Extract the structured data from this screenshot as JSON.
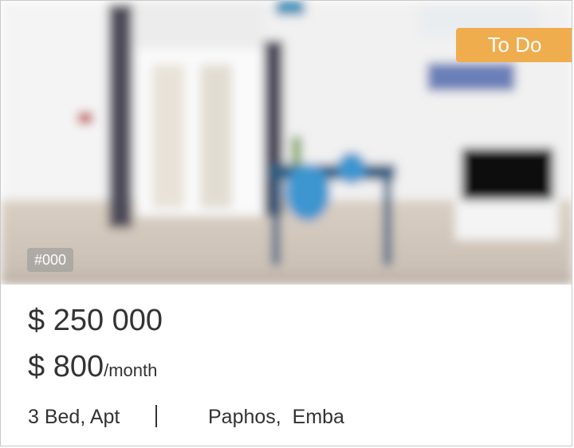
{
  "listing": {
    "status_badge": "To Do",
    "id_label": "#000",
    "sale_price": "$ 250 000",
    "rent_amount": "$ 800",
    "rent_period": "/month",
    "details": "3 Bed, Apt",
    "city": "Paphos,",
    "area": "Emba",
    "image_alt": "Apartment living room with blue chairs, dining table and TV",
    "colors": {
      "badge": "#F0AD4E",
      "text": "#333333"
    }
  }
}
